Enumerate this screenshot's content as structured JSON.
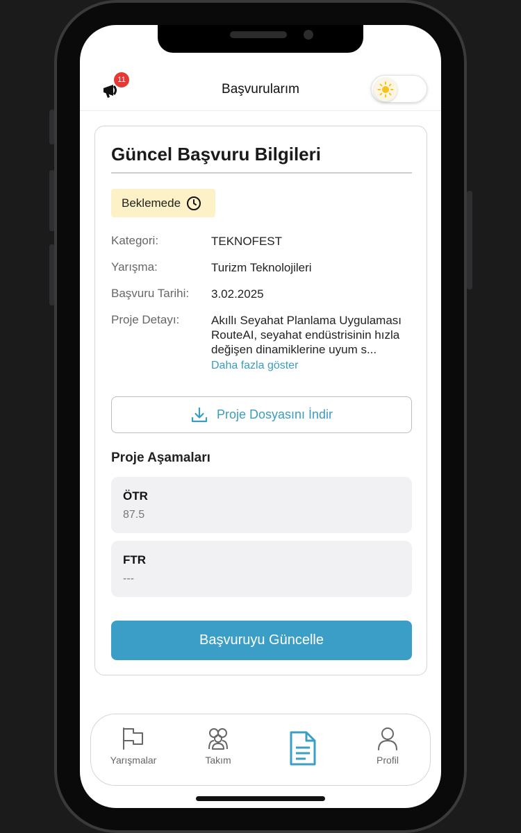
{
  "header": {
    "title": "Başvurularım",
    "notification_count": "11"
  },
  "card": {
    "title": "Güncel Başvuru Bilgileri",
    "status": "Beklemede",
    "fields": [
      {
        "label": "Kategori:",
        "value": "TEKNOFEST"
      },
      {
        "label": "Yarışma:",
        "value": "Turizm Teknolojileri"
      },
      {
        "label": "Başvuru Tarihi:",
        "value": "3.02.2025"
      },
      {
        "label": "Proje Detayı:",
        "value": "Akıllı Seyahat Planlama Uygulaması RouteAI, seyahat endüstrisinin hızla değişen dinamiklerine uyum s..."
      }
    ],
    "show_more": "Daha fazla göster",
    "download_label": "Proje Dosyasını İndir",
    "stages_title": "Proje Aşamaları",
    "stages": [
      {
        "name": "ÖTR",
        "score": "87.5"
      },
      {
        "name": "FTR",
        "score": "---"
      }
    ],
    "update_label": "Başvuruyu Güncelle"
  },
  "nav": {
    "items": [
      {
        "label": "Yarışmalar",
        "icon": "flag-icon"
      },
      {
        "label": "Takım",
        "icon": "team-icon"
      },
      {
        "label": "",
        "icon": "document-icon",
        "active": true
      },
      {
        "label": "Profil",
        "icon": "user-icon"
      }
    ]
  },
  "colors": {
    "accent": "#3a9ec7",
    "badge": "#e53935",
    "status_bg": "#fdf1c7",
    "stage_bg": "#f1f1f3"
  }
}
